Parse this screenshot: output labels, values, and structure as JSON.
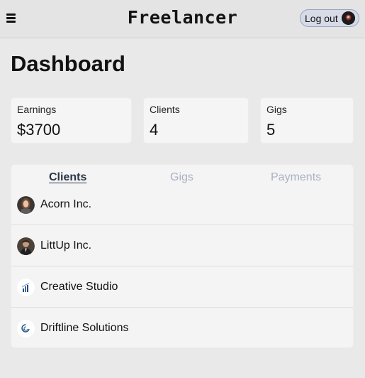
{
  "header": {
    "brand": "Freelancer",
    "logout_label": "Log out"
  },
  "page": {
    "title": "Dashboard"
  },
  "stats": [
    {
      "label": "Earnings",
      "value": "$3700"
    },
    {
      "label": "Clients",
      "value": "4"
    },
    {
      "label": "Gigs",
      "value": "5"
    }
  ],
  "tabs": [
    {
      "label": "Clients",
      "active": true
    },
    {
      "label": "Gigs",
      "active": false
    },
    {
      "label": "Payments",
      "active": false
    }
  ],
  "clients": [
    {
      "name": "Acorn Inc.",
      "avatar": "portrait-woman-avatar"
    },
    {
      "name": "LittUp Inc.",
      "avatar": "portrait-man-avatar"
    },
    {
      "name": "Creative Studio",
      "avatar": "bar-chart-logo-icon"
    },
    {
      "name": "Driftline Solutions",
      "avatar": "swirl-logo-icon"
    }
  ],
  "colors": {
    "background": "#e9e9e9",
    "card": "#f5f5f5",
    "tab_active": "#2a3547",
    "tab_inactive": "#a9b1c3",
    "logout_bg": "#d6dbe7"
  }
}
